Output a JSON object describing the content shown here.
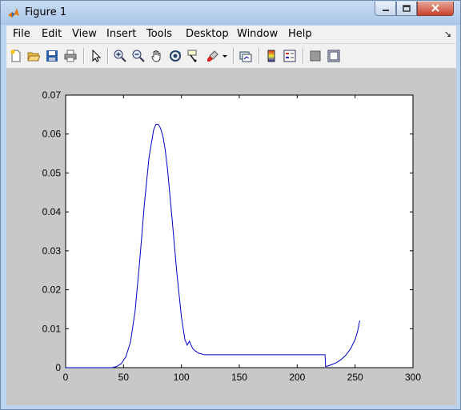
{
  "window": {
    "title": "Figure 1"
  },
  "menu": [
    "File",
    "Edit",
    "View",
    "Insert",
    "Tools",
    "Desktop",
    "Window",
    "Help"
  ],
  "toolbar": {
    "icons": [
      "new-figure-icon",
      "open-file-icon",
      "save-icon",
      "print-icon",
      "edit-plot-arrow-icon",
      "zoom-in-icon",
      "zoom-out-icon",
      "pan-hand-icon",
      "rotate-3d-icon",
      "data-cursor-icon",
      "brush-icon",
      "brush-dropdown-icon",
      "link-plot-icon",
      "colorbar-icon",
      "legend-icon",
      "hide-plot-tools-icon",
      "show-plot-tools-icon"
    ]
  },
  "colors": {
    "line": "#0000c8",
    "figure_bg": "#c8c8c8",
    "axes_bg": "#ffffff"
  },
  "chart_data": {
    "type": "line",
    "title": "",
    "xlabel": "",
    "ylabel": "",
    "xlim": [
      0,
      300
    ],
    "ylim": [
      0,
      0.07
    ],
    "xticks": [
      "0",
      "50",
      "100",
      "150",
      "200",
      "250",
      "300"
    ],
    "yticks": [
      "0",
      "0.01",
      "0.02",
      "0.03",
      "0.04",
      "0.05",
      "0.06",
      "0.07"
    ],
    "grid": false,
    "series": [
      {
        "x": [
          0,
          40,
          44,
          48,
          52,
          56,
          60,
          64,
          68,
          72,
          76,
          78,
          80,
          82,
          84,
          86,
          88,
          92,
          96,
          100,
          103,
          104,
          105,
          106,
          107,
          108,
          110,
          112,
          115,
          120,
          130,
          150,
          170,
          190,
          210,
          220,
          223,
          224,
          224.5,
          226,
          230,
          234,
          238,
          242,
          246,
          250,
          252,
          254
        ],
        "y": [
          0,
          0,
          0.0003,
          0.001,
          0.0028,
          0.0065,
          0.0145,
          0.0275,
          0.042,
          0.054,
          0.061,
          0.0625,
          0.0625,
          0.0615,
          0.0595,
          0.056,
          0.051,
          0.038,
          0.0245,
          0.013,
          0.0072,
          0.0065,
          0.0058,
          0.0063,
          0.0068,
          0.006,
          0.0048,
          0.0043,
          0.0037,
          0.0033,
          0.0033,
          0.0033,
          0.0033,
          0.0033,
          0.0033,
          0.0033,
          0.0033,
          0.0033,
          0.0003,
          0.0004,
          0.0008,
          0.0013,
          0.0021,
          0.0032,
          0.0048,
          0.0072,
          0.0092,
          0.0121
        ]
      }
    ]
  }
}
